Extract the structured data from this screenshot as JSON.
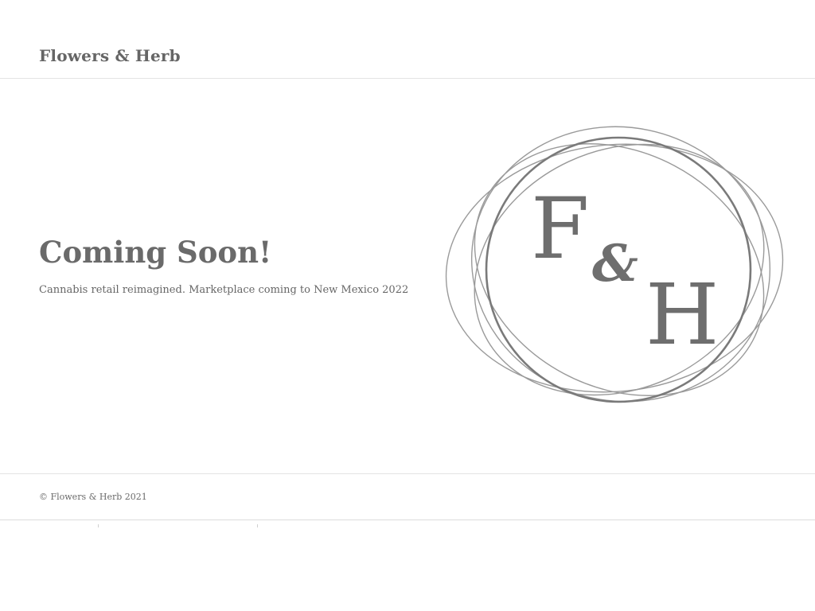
{
  "header": {
    "brand": "Flowers & Herb"
  },
  "hero": {
    "title": "Coming Soon!",
    "subtitle": "Cannabis retail reimagined. Marketplace coming to New Mexico 2022"
  },
  "logo": {
    "letter_f": "F",
    "ampersand": "&",
    "letter_h": "H",
    "color": "#6e6e6e",
    "ring_color": "#9a9a9a"
  },
  "footer": {
    "copyright": "© Flowers & Herb 2021"
  }
}
